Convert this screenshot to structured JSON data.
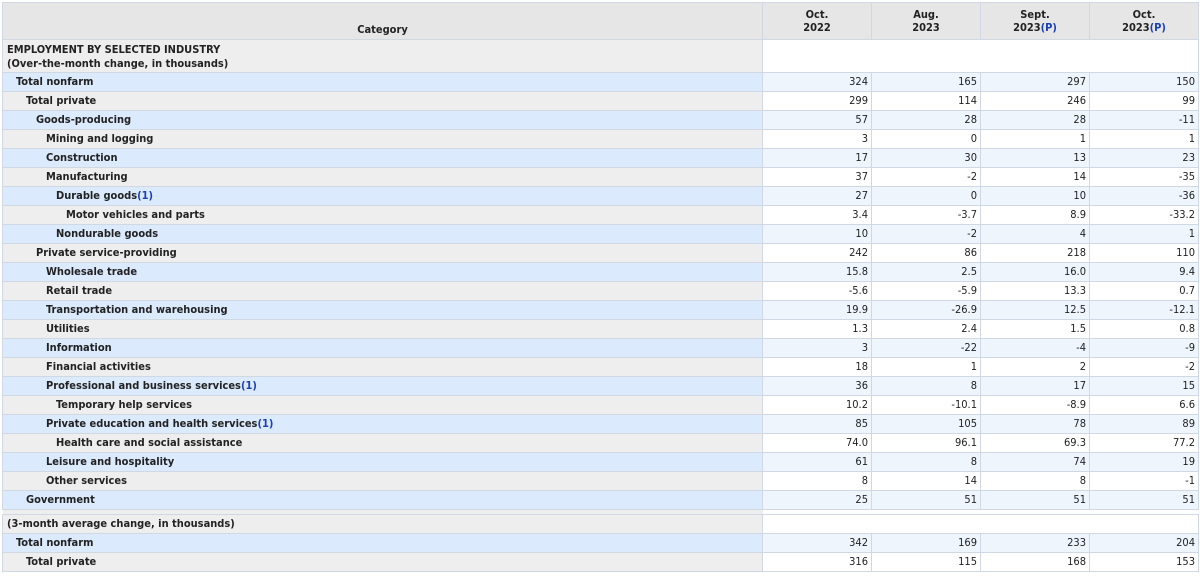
{
  "header": {
    "category": "Category",
    "periods": [
      {
        "line1": "Oct.",
        "line2": "2022",
        "mark": ""
      },
      {
        "line1": "Aug.",
        "line2": "2023",
        "mark": ""
      },
      {
        "line1": "Sept.",
        "line2": "2023",
        "mark": "(P)"
      },
      {
        "line1": "Oct.",
        "line2": "2023",
        "mark": "(P)"
      }
    ]
  },
  "section1": {
    "title": "EMPLOYMENT BY SELECTED INDUSTRY",
    "subtitle": "(Over-the-month change, in thousands)"
  },
  "rows1": [
    {
      "label": "Total nonfarm",
      "indent": 1,
      "fn": "",
      "values": [
        "324",
        "165",
        "297",
        "150"
      ]
    },
    {
      "label": "Total private",
      "indent": 2,
      "fn": "",
      "values": [
        "299",
        "114",
        "246",
        "99"
      ]
    },
    {
      "label": "Goods-producing",
      "indent": 3,
      "fn": "",
      "values": [
        "57",
        "28",
        "28",
        "-11"
      ]
    },
    {
      "label": "Mining and logging",
      "indent": 4,
      "fn": "",
      "values": [
        "3",
        "0",
        "1",
        "1"
      ]
    },
    {
      "label": "Construction",
      "indent": 4,
      "fn": "",
      "values": [
        "17",
        "30",
        "13",
        "23"
      ]
    },
    {
      "label": "Manufacturing",
      "indent": 4,
      "fn": "",
      "values": [
        "37",
        "-2",
        "14",
        "-35"
      ]
    },
    {
      "label": "Durable goods",
      "indent": 5,
      "fn": "(1)",
      "values": [
        "27",
        "0",
        "10",
        "-36"
      ]
    },
    {
      "label": "Motor vehicles and parts",
      "indent": 6,
      "fn": "",
      "values": [
        "3.4",
        "-3.7",
        "8.9",
        "-33.2"
      ]
    },
    {
      "label": "Nondurable goods",
      "indent": 5,
      "fn": "",
      "values": [
        "10",
        "-2",
        "4",
        "1"
      ]
    },
    {
      "label": "Private service-providing",
      "indent": 3,
      "fn": "",
      "values": [
        "242",
        "86",
        "218",
        "110"
      ]
    },
    {
      "label": "Wholesale trade",
      "indent": 4,
      "fn": "",
      "values": [
        "15.8",
        "2.5",
        "16.0",
        "9.4"
      ]
    },
    {
      "label": "Retail trade",
      "indent": 4,
      "fn": "",
      "values": [
        "-5.6",
        "-5.9",
        "13.3",
        "0.7"
      ]
    },
    {
      "label": "Transportation and warehousing",
      "indent": 4,
      "fn": "",
      "values": [
        "19.9",
        "-26.9",
        "12.5",
        "-12.1"
      ]
    },
    {
      "label": "Utilities",
      "indent": 4,
      "fn": "",
      "values": [
        "1.3",
        "2.4",
        "1.5",
        "0.8"
      ]
    },
    {
      "label": "Information",
      "indent": 4,
      "fn": "",
      "values": [
        "3",
        "-22",
        "-4",
        "-9"
      ]
    },
    {
      "label": "Financial activities",
      "indent": 4,
      "fn": "",
      "values": [
        "18",
        "1",
        "2",
        "-2"
      ]
    },
    {
      "label": "Professional and business services",
      "indent": 4,
      "fn": "(1)",
      "values": [
        "36",
        "8",
        "17",
        "15"
      ]
    },
    {
      "label": "Temporary help services",
      "indent": 5,
      "fn": "",
      "values": [
        "10.2",
        "-10.1",
        "-8.9",
        "6.6"
      ]
    },
    {
      "label": "Private education and health services",
      "indent": 4,
      "fn": "(1)",
      "values": [
        "85",
        "105",
        "78",
        "89"
      ]
    },
    {
      "label": "Health care and social assistance",
      "indent": 5,
      "fn": "",
      "values": [
        "74.0",
        "96.1",
        "69.3",
        "77.2"
      ]
    },
    {
      "label": "Leisure and hospitality",
      "indent": 4,
      "fn": "",
      "values": [
        "61",
        "8",
        "74",
        "19"
      ]
    },
    {
      "label": "Other services",
      "indent": 4,
      "fn": "",
      "values": [
        "8",
        "14",
        "8",
        "-1"
      ]
    },
    {
      "label": "Government",
      "indent": 2,
      "fn": "",
      "values": [
        "25",
        "51",
        "51",
        "51"
      ]
    }
  ],
  "section2": {
    "subtitle": "(3-month average change, in thousands)"
  },
  "rows2": [
    {
      "label": "Total nonfarm",
      "indent": 1,
      "fn": "",
      "values": [
        "342",
        "169",
        "233",
        "204"
      ]
    },
    {
      "label": "Total private",
      "indent": 2,
      "fn": "",
      "values": [
        "316",
        "115",
        "168",
        "153"
      ]
    }
  ]
}
